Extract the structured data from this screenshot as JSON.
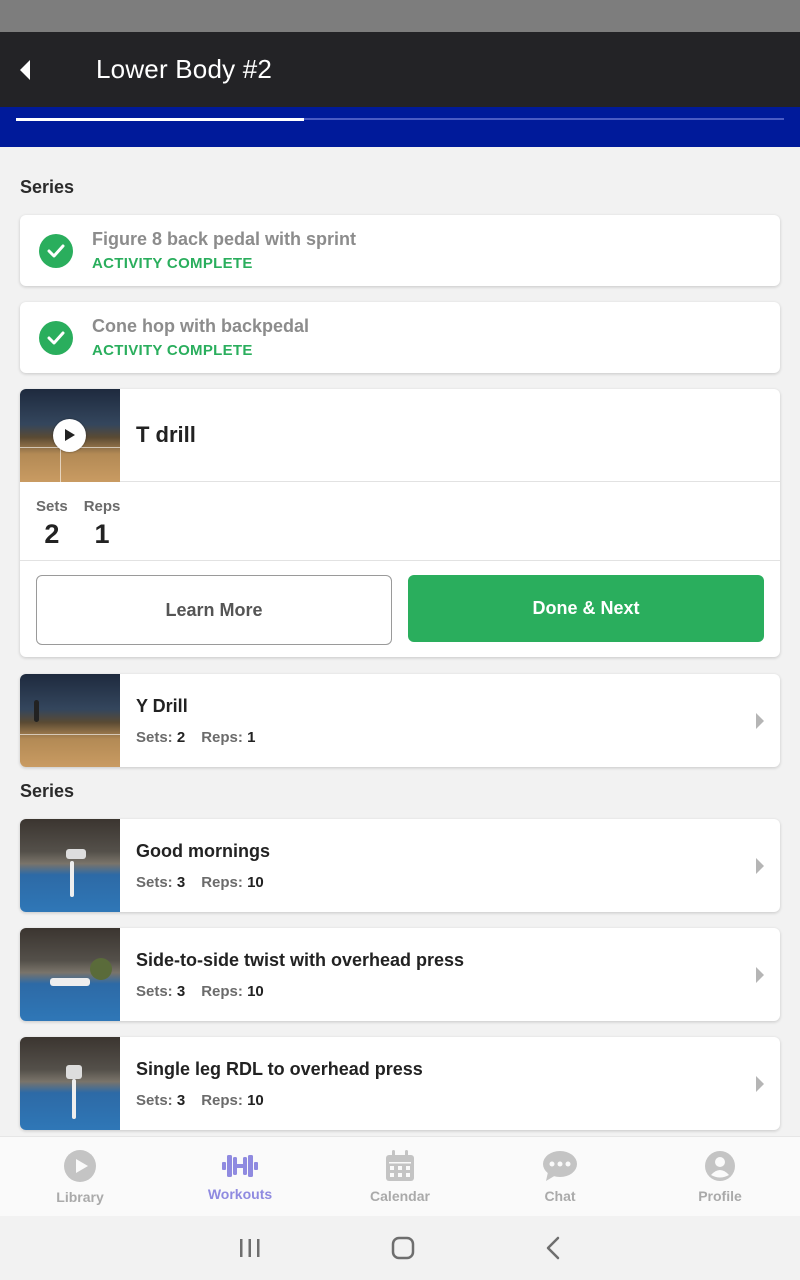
{
  "header": {
    "title": "Lower Body #2"
  },
  "progress": {
    "value": 0.375
  },
  "sections": [
    {
      "label": "Series"
    },
    {
      "label": "Series"
    }
  ],
  "completed": [
    {
      "name": "Figure 8 back pedal with sprint",
      "status": "ACTIVITY COMPLETE"
    },
    {
      "name": "Cone hop with backpedal",
      "status": "ACTIVITY COMPLETE"
    }
  ],
  "active": {
    "name": "T drill",
    "sets_label": "Sets",
    "sets": "2",
    "reps_label": "Reps",
    "reps": "1",
    "learn_more": "Learn More",
    "done_next": "Done & Next"
  },
  "exercises": [
    {
      "name": "Y Drill",
      "sets_label": "Sets:",
      "sets": "2",
      "reps_label": "Reps:",
      "reps": "1"
    },
    {
      "name": "Good mornings",
      "sets_label": "Sets:",
      "sets": "3",
      "reps_label": "Reps:",
      "reps": "10"
    },
    {
      "name": "Side-to-side twist with overhead press",
      "sets_label": "Sets:",
      "sets": "3",
      "reps_label": "Reps:",
      "reps": "10"
    },
    {
      "name": "Single leg RDL to overhead press",
      "sets_label": "Sets:",
      "sets": "3",
      "reps_label": "Reps:",
      "reps": "10"
    }
  ],
  "nav": [
    {
      "label": "Library",
      "icon": "play-circle-icon"
    },
    {
      "label": "Workouts",
      "icon": "dumbbell-icon",
      "active": true
    },
    {
      "label": "Calendar",
      "icon": "calendar-icon"
    },
    {
      "label": "Chat",
      "icon": "chat-icon"
    },
    {
      "label": "Profile",
      "icon": "profile-icon"
    }
  ],
  "colors": {
    "header_bg": "#232326",
    "progress_band": "#001a9a",
    "accent_green": "#2aae5d",
    "nav_active": "#8f8ae0",
    "nav_inactive": "#aaaaaa"
  }
}
